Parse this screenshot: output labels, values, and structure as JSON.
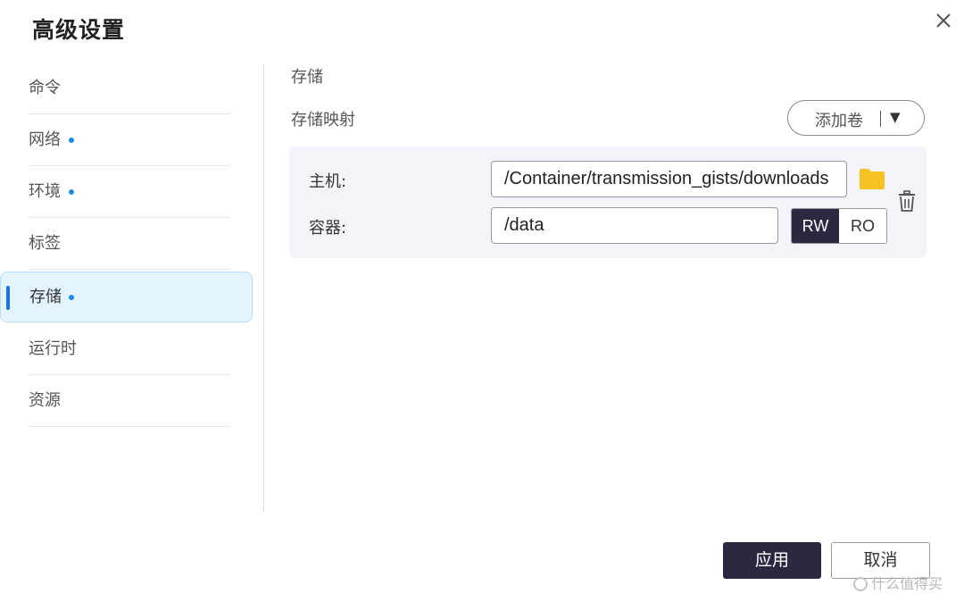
{
  "dialog": {
    "title": "高级设置",
    "close_icon": "close-icon"
  },
  "sidebar": {
    "items": [
      {
        "label": "命令",
        "modified": false,
        "active": false
      },
      {
        "label": "网络",
        "modified": true,
        "active": false
      },
      {
        "label": "环境",
        "modified": true,
        "active": false
      },
      {
        "label": "标签",
        "modified": false,
        "active": false
      },
      {
        "label": "存储",
        "modified": true,
        "active": true
      },
      {
        "label": "运行时",
        "modified": false,
        "active": false
      },
      {
        "label": "资源",
        "modified": false,
        "active": false
      }
    ]
  },
  "storage": {
    "section_title": "存储",
    "mapping_title": "存储映射",
    "add_volume_label": "添加卷",
    "host_label": "主机:",
    "host_value": "/Container/transmission_gists/downloads",
    "container_label": "容器:",
    "container_value": "/data",
    "modes": [
      "RW",
      "RO"
    ],
    "selected_mode": "RW"
  },
  "footer": {
    "apply_label": "应用",
    "cancel_label": "取消"
  },
  "watermark": {
    "text": "什么值得买"
  },
  "colors": {
    "accent_dark": "#2b2842",
    "active_bg": "#e3f4fd",
    "dot": "#1e88e5",
    "indicator": "#1a73e8",
    "folder": "#f7c324"
  }
}
